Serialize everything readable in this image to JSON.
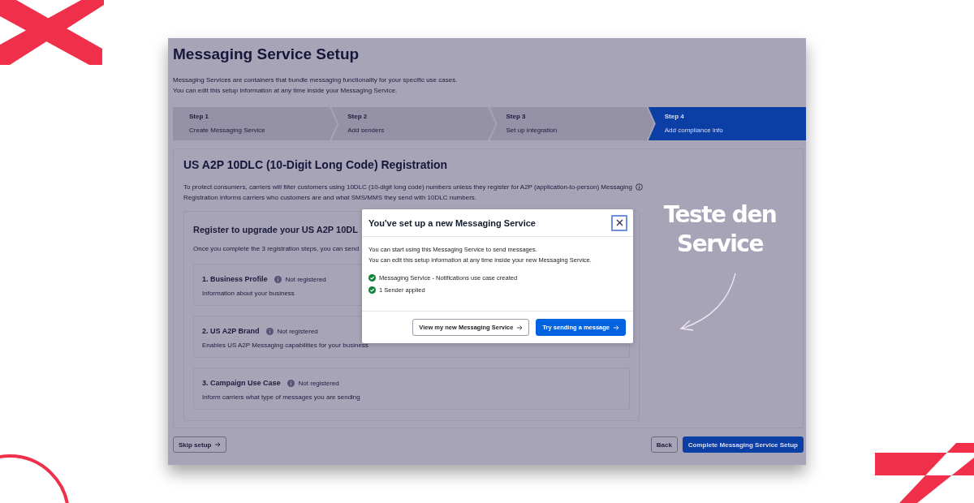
{
  "page": {
    "title": "Messaging Service Setup",
    "description": [
      "Messaging Services are containers that bundle messaging functionality for your specific use cases.",
      "You can edit this setup information at any time inside your Messaging Service."
    ]
  },
  "steps": [
    {
      "label": "Step 1",
      "name": "Create Messaging Service",
      "selected": false
    },
    {
      "label": "Step 2",
      "name": "Add senders",
      "selected": false
    },
    {
      "label": "Step 3",
      "name": "Set up integration",
      "selected": false
    },
    {
      "label": "Step 4",
      "name": "Add compliance info",
      "selected": true
    }
  ],
  "registration": {
    "title": "US A2P 10DLC (10-Digit Long Code) Registration",
    "description": [
      "To protect consumers, carriers will filter customers using 10DLC (10-digit long code) numbers unless they register for A2P (application-to-person) Messaging",
      "Registration informs carriers who customers are and what SMS/MMS they send with 10DLC numbers."
    ],
    "register_box": {
      "title": "Register to upgrade your US A2P 10DL",
      "intro": "Once you complete the 3 registration steps, you can send",
      "cards": [
        {
          "title": "1. Business Profile",
          "status": "Not registered",
          "description": "Information about your business"
        },
        {
          "title": "2. US A2P Brand",
          "status": "Not registered",
          "description": "Enables US A2P Messaging capabilities for your business"
        },
        {
          "title": "3. Campaign Use Case",
          "status": "Not registered",
          "description": "Inform carriers what type of messages you are sending"
        }
      ]
    }
  },
  "footer": {
    "skip": "Skip setup",
    "back": "Back",
    "complete": "Complete Messaging Service Setup"
  },
  "modal": {
    "title": "You've set up a new Messaging Service",
    "body": [
      "You can start using this Messaging Service to send messages.",
      "You can edit this setup information at any time inside your new Messaging Service."
    ],
    "checklist": [
      {
        "text": "Messaging Service - Notifications use case created",
        "done": true
      },
      {
        "text": "1 Sender applied",
        "done": true
      }
    ],
    "buttons": [
      {
        "label": "View my new Messaging Service",
        "kind": "secondary"
      },
      {
        "label": "Try sending a message",
        "kind": "primary"
      }
    ]
  },
  "annotation": {
    "lines": [
      "Teste den",
      "Service"
    ]
  }
}
